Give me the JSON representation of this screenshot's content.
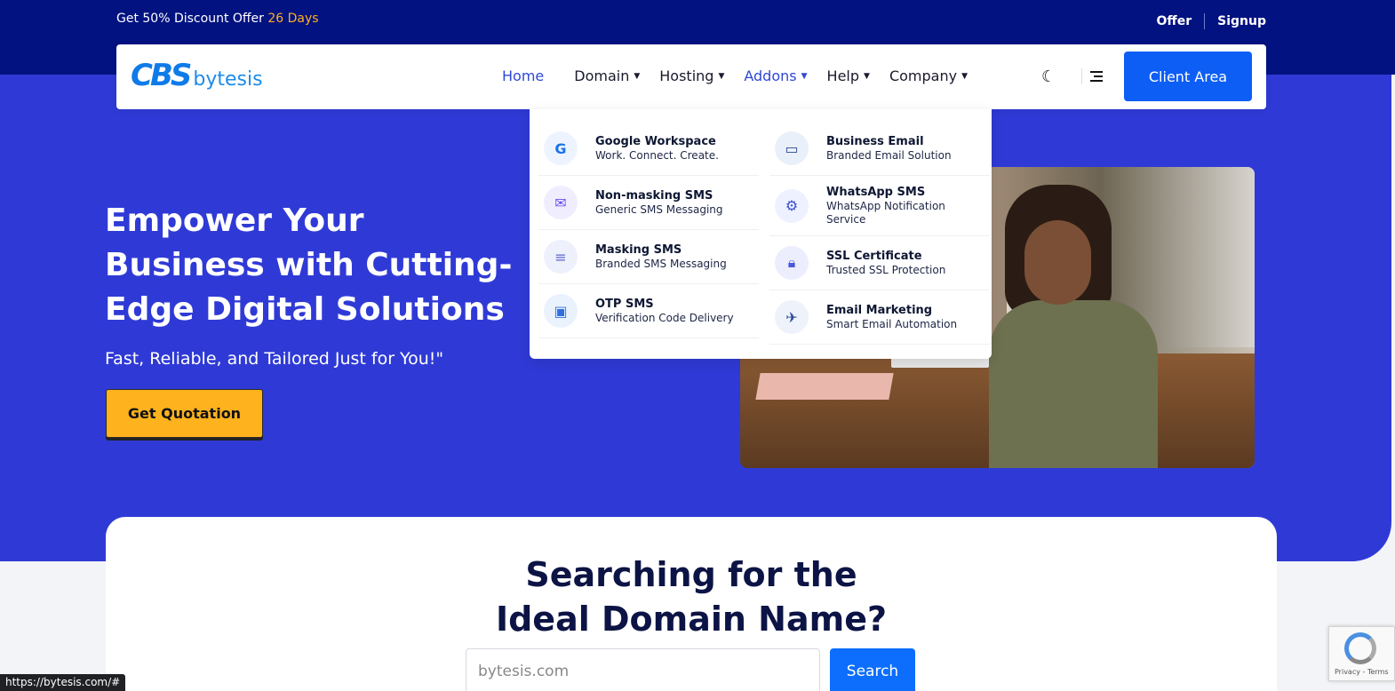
{
  "topbar": {
    "offer_prefix": "Get 50% Discount Offer",
    "offer_days": "26 Days",
    "offer_link": "Offer",
    "signup_link": "Signup"
  },
  "logo": {
    "mark": "CBS",
    "word": "bytesis"
  },
  "nav": {
    "items": [
      {
        "label": "Home"
      },
      {
        "label": "Domain"
      },
      {
        "label": "Hosting"
      },
      {
        "label": "Addons"
      },
      {
        "label": "Help"
      },
      {
        "label": "Company"
      }
    ],
    "client_area": "Client Area"
  },
  "addons_menu": {
    "left": [
      {
        "title": "Google Workspace",
        "subtitle": "Work. Connect. Create."
      },
      {
        "title": "Non-masking SMS",
        "subtitle": "Generic SMS Messaging"
      },
      {
        "title": "Masking SMS",
        "subtitle": "Branded SMS Messaging"
      },
      {
        "title": "OTP SMS",
        "subtitle": "Verification Code Delivery"
      }
    ],
    "right": [
      {
        "title": "Business Email",
        "subtitle": "Branded Email Solution"
      },
      {
        "title": "WhatsApp SMS",
        "subtitle": "WhatsApp Notification Service"
      },
      {
        "title": "SSL Certificate",
        "subtitle": "Trusted SSL Protection"
      },
      {
        "title": "Email Marketing",
        "subtitle": "Smart Email Automation"
      }
    ]
  },
  "hero": {
    "title": "Empower Your Business with Cutting-Edge Digital Solutions",
    "subtitle": "Fast, Reliable, and Tailored Just for You!\"",
    "cta": "Get Quotation"
  },
  "domain_search": {
    "title": "Searching for the Ideal Domain Name?",
    "placeholder": "bytesis.com",
    "button": "Search"
  },
  "status_url": "https://bytesis.com/#",
  "recaptcha": {
    "text": "Privacy - Terms"
  },
  "colors": {
    "topbar": "#021280",
    "hero": "#2f3ad6",
    "accent": "#0d5ef5",
    "cta": "#fdb21e",
    "offer_days": "#ffb020"
  }
}
